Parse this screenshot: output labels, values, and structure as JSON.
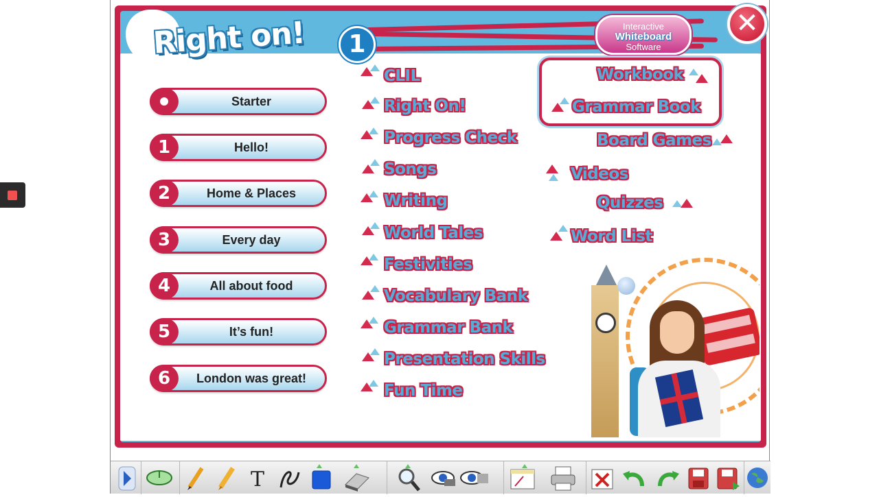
{
  "brand": {
    "title": "Right on!",
    "level": "1"
  },
  "badge": {
    "line1": "Interactive",
    "line2": "Whiteboard",
    "line3": "Software"
  },
  "close": {
    "glyph": "✕"
  },
  "units": [
    {
      "num": "",
      "label": "Starter"
    },
    {
      "num": "1",
      "label": "Hello!"
    },
    {
      "num": "2",
      "label": "Home & Places"
    },
    {
      "num": "3",
      "label": "Every day"
    },
    {
      "num": "4",
      "label": "All about food"
    },
    {
      "num": "5",
      "label": "It’s fun!"
    },
    {
      "num": "6",
      "label": "London was great!"
    }
  ],
  "resources_col1": [
    "CLIL",
    "Right On!",
    "Progress Check",
    "Songs",
    "Writing",
    "World Tales",
    "Festivities",
    "Vocabulary Bank",
    "Grammar Bank",
    "Presentation Skills",
    "Fun Time"
  ],
  "resources_col2": {
    "workbook": "Workbook",
    "grammar_book": "Grammar Book",
    "board_games": "Board Games",
    "videos": "Videos",
    "quizzes": "Quizzes",
    "word_list": "Word List"
  },
  "toolbar": {
    "items": [
      "nav-arrow-icon",
      "mouse-icon",
      "pencil-icon",
      "highlighter-icon",
      "text-icon",
      "freehand-icon",
      "shape-icon",
      "eraser-icon",
      "zoom-icon",
      "spotlight-icon",
      "reveal-icon",
      "page-icon",
      "print-icon",
      "clear-icon",
      "undo-icon",
      "redo-icon",
      "save-icon",
      "save-as-icon",
      "globe-icon"
    ],
    "text_tool_glyph": "T"
  },
  "colors": {
    "brand_red": "#c8234a",
    "brand_blue": "#60b8de",
    "link_blue": "#5aaad6"
  }
}
